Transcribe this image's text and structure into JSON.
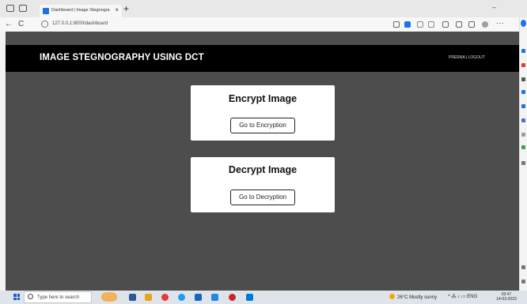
{
  "browser": {
    "tab_title": "Dashboard | Image Stegnograph",
    "tab_close": "×",
    "new_tab": "+",
    "url": "127.0.0.1:8000/dashboard",
    "back": "←",
    "refresh": "C",
    "more": "···",
    "minimize": "–"
  },
  "header": {
    "title": "IMAGE STEGNOGRAPHY USING DCT",
    "user_links": "PRERNA | LOGOUT"
  },
  "cards": {
    "encrypt": {
      "title": "Encrypt Image",
      "button": "Go to Encryption"
    },
    "decrypt": {
      "title": "Decrypt Image",
      "button": "Go to Decryption"
    }
  },
  "taskbar": {
    "search_placeholder": "Type here to search",
    "weather": "26°C  Mostly sunny",
    "tray": "^  ⁂  ♪  ▭  ENG",
    "time": "03:47",
    "date": "14-03-2023"
  },
  "colors": {
    "page_bg": "#4d4d4d",
    "header_bg": "#000000",
    "card_bg": "#ffffff"
  }
}
